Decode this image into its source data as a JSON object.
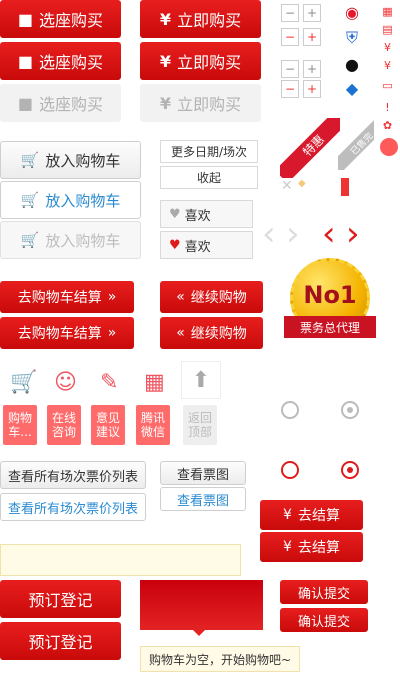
{
  "buttons": {
    "select_seat": "选座购买",
    "buy_now": "立即购买",
    "add_cart": "放入购物车",
    "cart_checkout": "去购物车结算",
    "continue_shop": "继续购物",
    "more_dates": "更多日期/场次",
    "collapse": "收起",
    "like": "喜欢",
    "view_all_prices": "查看所有场次票价列表",
    "view_seat_map": "查看票图",
    "checkout": "去结算",
    "reserve": "预订登记",
    "confirm_submit": "确认提交"
  },
  "badges": {
    "featured": "特惠",
    "sold_out": "已售完",
    "no1": "No1",
    "agent": "票务总代理"
  },
  "tiles": {
    "cart": "购物车...",
    "online": "在线咨询",
    "feedback": "意见建议",
    "wechat": "腾讯微信",
    "top": "返回顶部"
  },
  "tooltip": {
    "empty_cart": "购物车为空，开始购物吧~"
  },
  "symbols": {
    "yen": "¥",
    "plus": "+",
    "minus": "−",
    "chev_right": "»",
    "chev_left": "«"
  },
  "colors": {
    "red": "#e01b1b",
    "gray": "#f2f2f2",
    "blue": "#2a8bd1",
    "gold": "#f4b300"
  }
}
